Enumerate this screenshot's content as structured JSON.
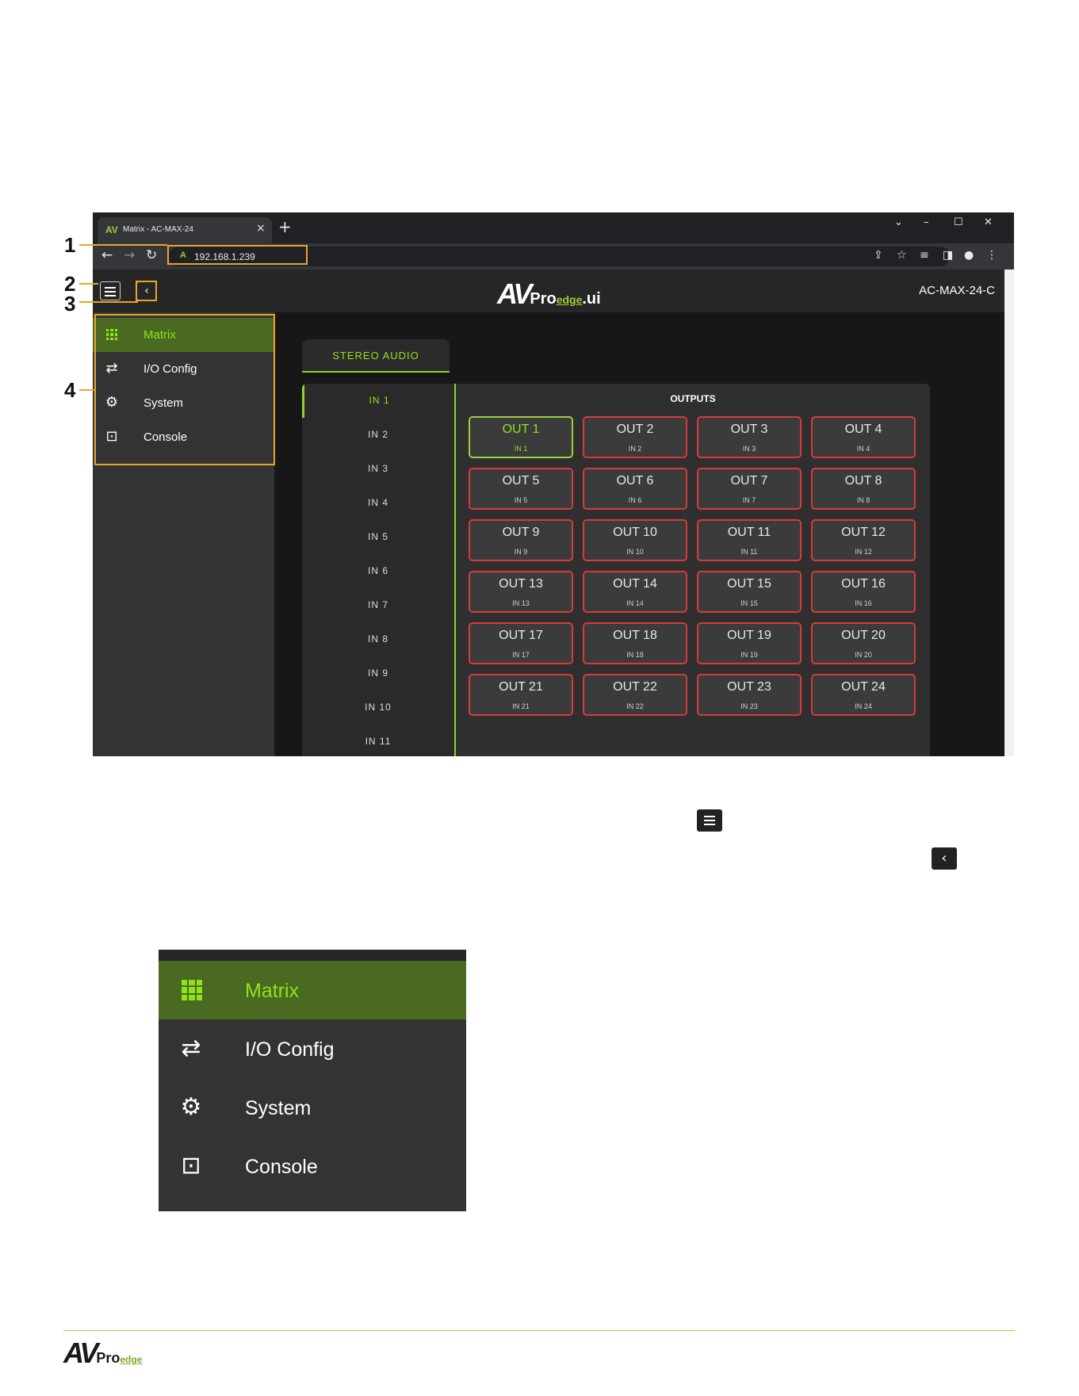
{
  "browser": {
    "tab_title": "Matrix - AC-MAX-24",
    "favicon": "AV",
    "url": "192.168.1.239",
    "new_tab": "+",
    "close_tab": "×"
  },
  "app": {
    "logo_av": "AV",
    "logo_pro": "Pro",
    "logo_edge": "edge",
    "logo_ui": ".ui",
    "device_name": "AC-MAX-24-C",
    "selected_tab": "STEREO AUDIO",
    "outputs_title": "OUTPUTS",
    "menu": [
      {
        "label": "Matrix",
        "icon": "grid-icon",
        "active": true
      },
      {
        "label": "I/O Config",
        "icon": "arrows-icon",
        "active": false
      },
      {
        "label": "System",
        "icon": "gear-icon",
        "active": false
      },
      {
        "label": "Console",
        "icon": "terminal-icon",
        "active": false
      }
    ],
    "inputs": [
      "IN 1",
      "IN 2",
      "IN 3",
      "IN 4",
      "IN 5",
      "IN 6",
      "IN 7",
      "IN 8",
      "IN 9",
      "IN 10",
      "IN 11"
    ],
    "outputs": [
      {
        "name": "OUT 1",
        "source": "IN 1"
      },
      {
        "name": "OUT 2",
        "source": "IN 2"
      },
      {
        "name": "OUT 3",
        "source": "IN 3"
      },
      {
        "name": "OUT 4",
        "source": "IN 4"
      },
      {
        "name": "OUT 5",
        "source": "IN 5"
      },
      {
        "name": "OUT 6",
        "source": "IN 6"
      },
      {
        "name": "OUT 7",
        "source": "IN 7"
      },
      {
        "name": "OUT 8",
        "source": "IN 8"
      },
      {
        "name": "OUT 9",
        "source": "IN 9"
      },
      {
        "name": "OUT 10",
        "source": "IN 10"
      },
      {
        "name": "OUT 11",
        "source": "IN 11"
      },
      {
        "name": "OUT 12",
        "source": "IN 12"
      },
      {
        "name": "OUT 13",
        "source": "IN 13"
      },
      {
        "name": "OUT 14",
        "source": "IN 14"
      },
      {
        "name": "OUT 15",
        "source": "IN 15"
      },
      {
        "name": "OUT 16",
        "source": "IN 16"
      },
      {
        "name": "OUT 17",
        "source": "IN 17"
      },
      {
        "name": "OUT 18",
        "source": "IN 18"
      },
      {
        "name": "OUT 19",
        "source": "IN 19"
      },
      {
        "name": "OUT 20",
        "source": "IN 20"
      },
      {
        "name": "OUT 21",
        "source": "IN 21"
      },
      {
        "name": "OUT 22",
        "source": "IN 22"
      },
      {
        "name": "OUT 23",
        "source": "IN 23"
      },
      {
        "name": "OUT 24",
        "source": "IN 24"
      }
    ]
  },
  "callouts": [
    "1",
    "2",
    "3",
    "4"
  ],
  "colors": {
    "accent_green": "#8fe31b",
    "active_bg": "#4a6a22",
    "output_border": "#d83a3a",
    "callout": "#e8a42a"
  },
  "footer": {
    "logo_av": "AV",
    "logo_pro": "Pro",
    "logo_edge": "edge"
  }
}
